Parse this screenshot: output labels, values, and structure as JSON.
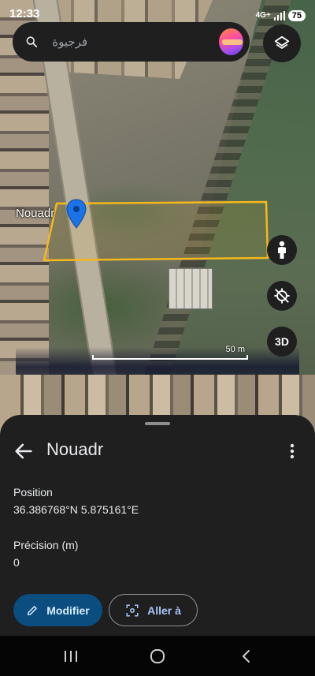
{
  "status_bar": {
    "time": "12:33",
    "network": "4G+",
    "battery": "75"
  },
  "search": {
    "placeholder": "فرجيوة"
  },
  "map": {
    "pin_label": "Nouadr",
    "scale_label": "50 m",
    "parcel_color": "#f5b81c",
    "pin_color": "#1a73e8",
    "controls": {
      "three_d_label": "3D"
    }
  },
  "sheet": {
    "title": "Nouadr",
    "fields": [
      {
        "label": "Position",
        "value": "36.386768°N 5.875161°E"
      },
      {
        "label": "Précision (m)",
        "value": "0"
      }
    ],
    "actions": {
      "modify_label": "Modifier",
      "goto_label": "Aller à"
    }
  },
  "icons": {
    "search": "search-icon",
    "layers": "layers-icon",
    "street_view": "pegman-icon",
    "gps_off": "location-disabled-icon",
    "back": "arrow-back-icon",
    "more": "more-vert-icon",
    "edit": "pencil-icon",
    "goto": "center-focus-icon"
  },
  "colors": {
    "sheet_background": "#1f1f1f",
    "primary_button": "#0b4d7e",
    "primary_button_text": "#d8ecff",
    "outline_button_text": "#a8c7fa"
  }
}
